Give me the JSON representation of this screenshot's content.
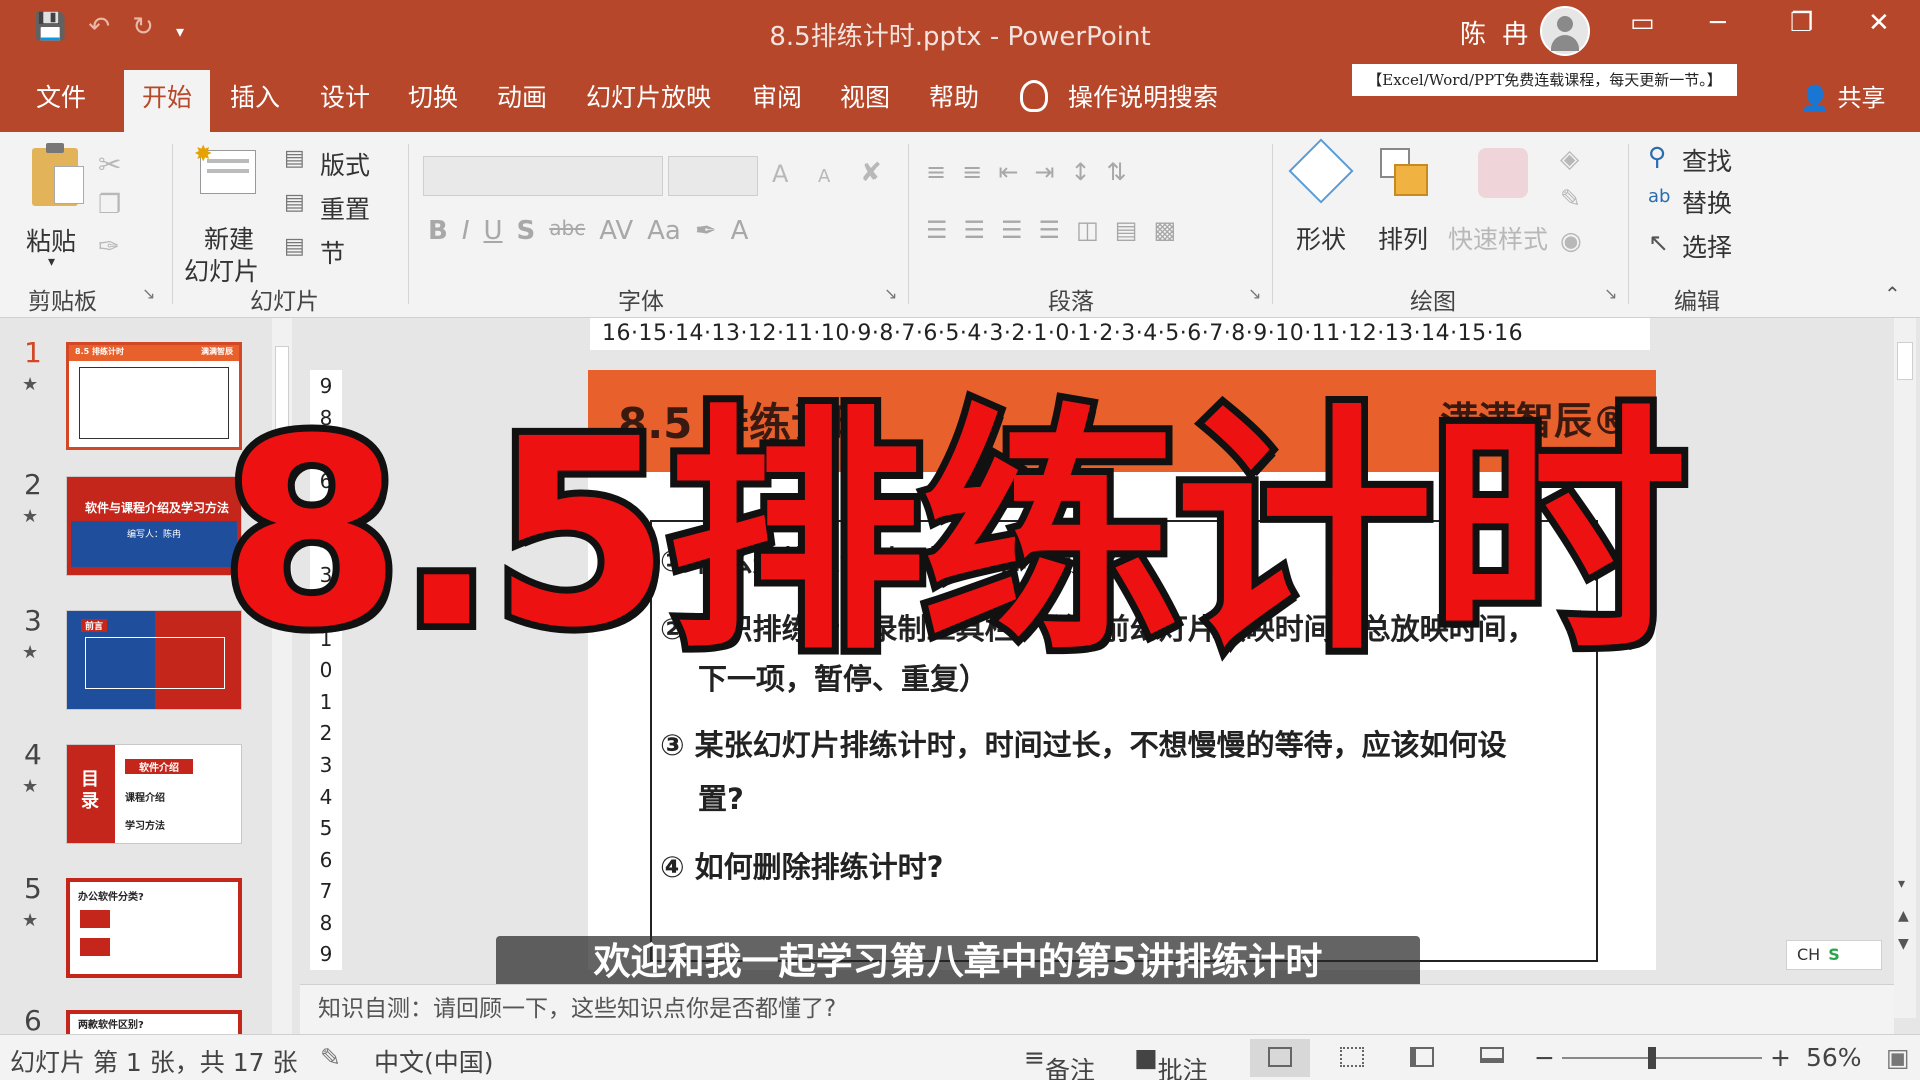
{
  "window": {
    "title": "8.5排练计时.pptx  -  PowerPoint",
    "user": "陈 冉",
    "qat_icons": [
      "save-icon",
      "undo-icon",
      "redo-icon",
      "customize-qat-icon"
    ],
    "controls": {
      "ribbon_display": "▭",
      "minimize": "─",
      "restore": "❐",
      "close": "✕"
    }
  },
  "tabs": [
    {
      "label": "文件",
      "active": false
    },
    {
      "label": "开始",
      "active": true
    },
    {
      "label": "插入",
      "active": false
    },
    {
      "label": "设计",
      "active": false
    },
    {
      "label": "切换",
      "active": false
    },
    {
      "label": "动画",
      "active": false
    },
    {
      "label": "幻灯片放映",
      "active": false
    },
    {
      "label": "审阅",
      "active": false
    },
    {
      "label": "视图",
      "active": false
    },
    {
      "label": "帮助",
      "active": false
    }
  ],
  "tellme": "操作说明搜索",
  "promo_banner": "【Excel/Word/PPT免费连载课程，每天更新一节。】",
  "share": "共享",
  "ribbon": {
    "clipboard": {
      "paste": "粘贴",
      "label": "剪贴板"
    },
    "slides": {
      "new_slide_line1": "新建",
      "new_slide_line2": "幻灯片",
      "layout": "版式",
      "reset": "重置",
      "section": "节",
      "label": "幻灯片"
    },
    "font": {
      "label": "字体",
      "bold": "B",
      "italic": "I",
      "underline": "U",
      "shadow": "S",
      "strike": "abc",
      "spacing": "AV",
      "case": "Aa",
      "color": "A",
      "grow": "A",
      "shrink": "A"
    },
    "paragraph": {
      "label": "段落"
    },
    "drawing": {
      "shapes": "形状",
      "arrange": "排列",
      "quick_styles": "快速样式",
      "label": "绘图"
    },
    "editing": {
      "find": "查找",
      "replace": "替换",
      "select": "选择",
      "label": "编辑"
    }
  },
  "thumbnails": [
    {
      "num": "1",
      "title": "8.5 排练计时",
      "brand": "满满智辰",
      "selected": true
    },
    {
      "num": "2",
      "title": "软件与课程介绍及学习方法",
      "subtitle": "编写人：陈冉",
      "selected": false
    },
    {
      "num": "3",
      "title": "前言",
      "selected": false
    },
    {
      "num": "4",
      "side": "目录",
      "items": [
        "软件介绍",
        "课程介绍",
        "学习方法"
      ],
      "selected": false
    },
    {
      "num": "5",
      "title": "办公软件分类?",
      "selected": false
    },
    {
      "num": "6",
      "title": "两款软件区别?",
      "selected": false
    }
  ],
  "ruler": {
    "horizontal": "16·15·14·13·12·11·10·9·8·7·6·5·4·3·2·1·0·1·2·3·4·5·6·7·8·9·10·11·12·13·14·15·16",
    "vertical": [
      "9",
      "8",
      "7",
      "6",
      "5",
      "4",
      "3",
      "2",
      "1",
      "0",
      "1",
      "2",
      "3",
      "4",
      "5",
      "6",
      "7",
      "8",
      "9"
    ]
  },
  "slide": {
    "title": "8.5 排练计时",
    "brand": "满满智辰®",
    "lines": [
      "① 什么是排练计时及排练计时作用?",
      "② 认识排练计时录制工具栏？（当前幻灯片放映时间与总放映时间，",
      "下一项，暂停、重复）",
      "③ 某张幻灯片排练计时，时间过长，不想慢慢的等待，应该如何设",
      "置?",
      "④ 如何删除排练计时?"
    ]
  },
  "overlay_title": "8.5排练计时",
  "subtitle": "欢迎和我一起学习第八章中的第5讲排练计时",
  "ime": {
    "lang": "CH",
    "logo": "S"
  },
  "notes": "知识自测：请回顾一下，这些知识点你是否都懂了?",
  "status": {
    "slide_info": "幻灯片 第 1 张，共 17 张",
    "language": "中文(中国)",
    "notes_btn": "备注",
    "comments_btn": "批注",
    "zoom_value": "56%",
    "zoom_fraction": 0.45
  }
}
